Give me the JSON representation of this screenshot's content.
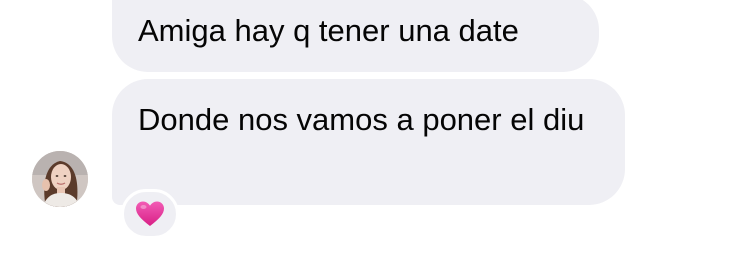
{
  "messages": [
    {
      "text": "Amiga hay q tener una date"
    },
    {
      "text": "Donde nos vamos a poner el diu"
    }
  ],
  "sender": {
    "avatar_icon": "user-avatar-photo"
  },
  "reaction": {
    "icon": "pink-heart-icon",
    "color": "#e62f9b"
  },
  "colors": {
    "bubble_bg": "#efeff4",
    "text": "#050505",
    "background": "#ffffff"
  }
}
